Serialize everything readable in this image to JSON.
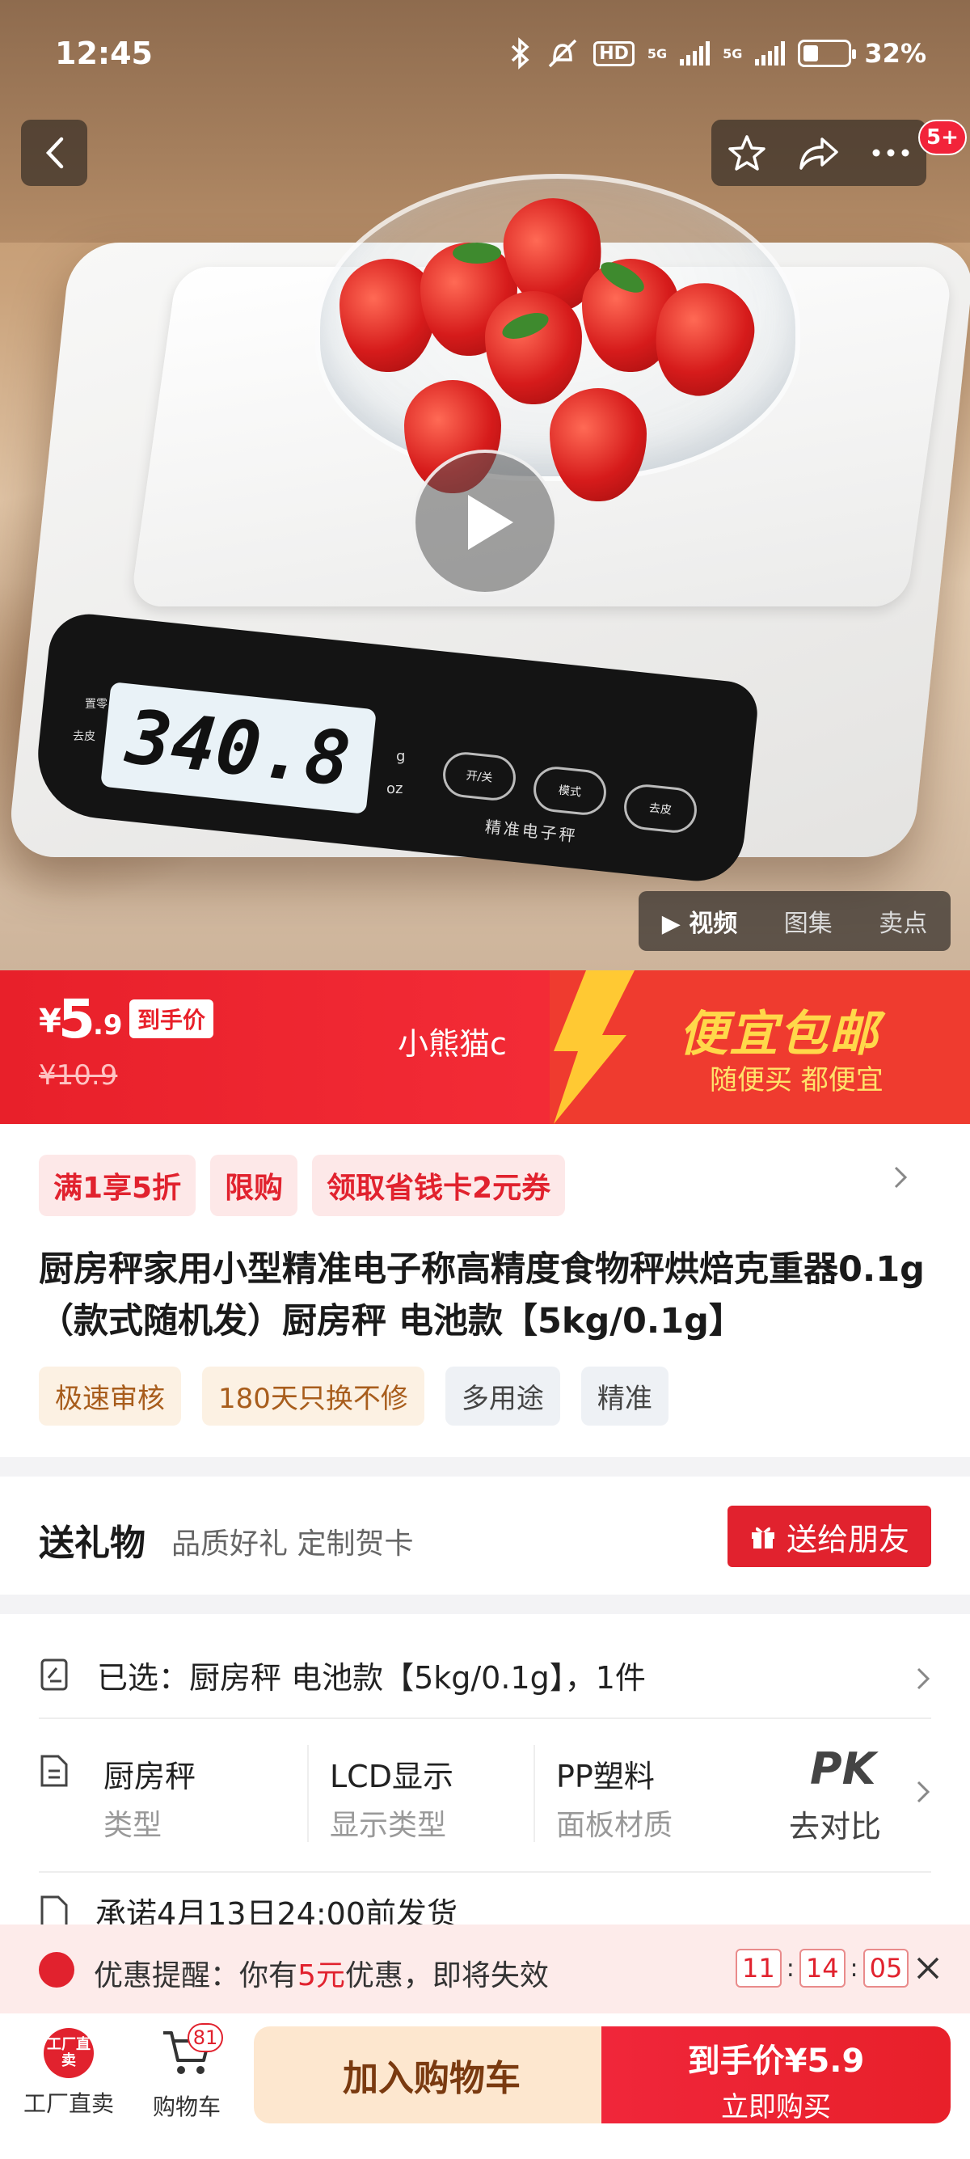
{
  "status_bar": {
    "time": "12:45",
    "hd": "HD",
    "net1": "5G",
    "net2": "5G",
    "battery": "32%",
    "battery_level": 0.32
  },
  "header": {
    "cart_badge": "5+"
  },
  "product_image": {
    "lcd_reading": "340.8",
    "lcd_unit_g": "g",
    "lcd_unit_oz": "oz",
    "btn_power": "开/关",
    "btn_mode": "模式",
    "btn_tare": "去皮",
    "brand_text": "精准电子秤",
    "zero_label": "置零",
    "tare_label": "去皮"
  },
  "media_tabs": {
    "video": "视频",
    "gallery": "图集",
    "selling": "卖点"
  },
  "price": {
    "currency": "¥",
    "integer": "5",
    "decimal": ".9",
    "final_tag": "到手价",
    "original": "¥10.9",
    "shop_name": "小熊猫c",
    "slogan": "便宜包邮",
    "slogan_sub": "随便买 都便宜"
  },
  "promotions": [
    "满1享5折",
    "限购",
    "领取省钱卡2元券"
  ],
  "product": {
    "title": "厨房秤家用小型精准电子称高精度食物秤烘焙克重器0.1g（款式随机发）厨房秤 电池款【5kg/0.1g】",
    "tags_warm": [
      "极速审核",
      "180天只换不修"
    ],
    "tags_cool": [
      "多用途",
      "精准"
    ]
  },
  "gift": {
    "title": "送礼物",
    "subtitle": "品质好礼 定制贺卡",
    "button": "送给朋友"
  },
  "specs": {
    "selected": "已选：厨房秤 电池款【5kg/0.1g】，1件",
    "attrs": [
      {
        "value": "厨房秤",
        "key": "类型"
      },
      {
        "value": "LCD显示",
        "key": "显示类型"
      },
      {
        "value": "PP塑料",
        "key": "面板材质"
      }
    ],
    "pk": "PK",
    "compare": "去对比",
    "shipping": "承诺4月13日24:00前发货"
  },
  "reminder": {
    "prefix": "优惠提醒：你有",
    "amount": "5元",
    "suffix": "优惠，即将失效",
    "hh": "11",
    "mm": "14",
    "ss": "05"
  },
  "bottom_bar": {
    "factory_logo": "工厂直卖",
    "factory_label": "工厂直卖",
    "cart_label": "购物车",
    "cart_count": "81",
    "add_to_cart": "加入购物车",
    "buy_price": "到手价¥5.9",
    "buy_now": "立即购买"
  },
  "colors": {
    "accent": "#e1222e",
    "banner_yellow": "#ffd84a",
    "add_cart_bg": "#fde7cf"
  }
}
